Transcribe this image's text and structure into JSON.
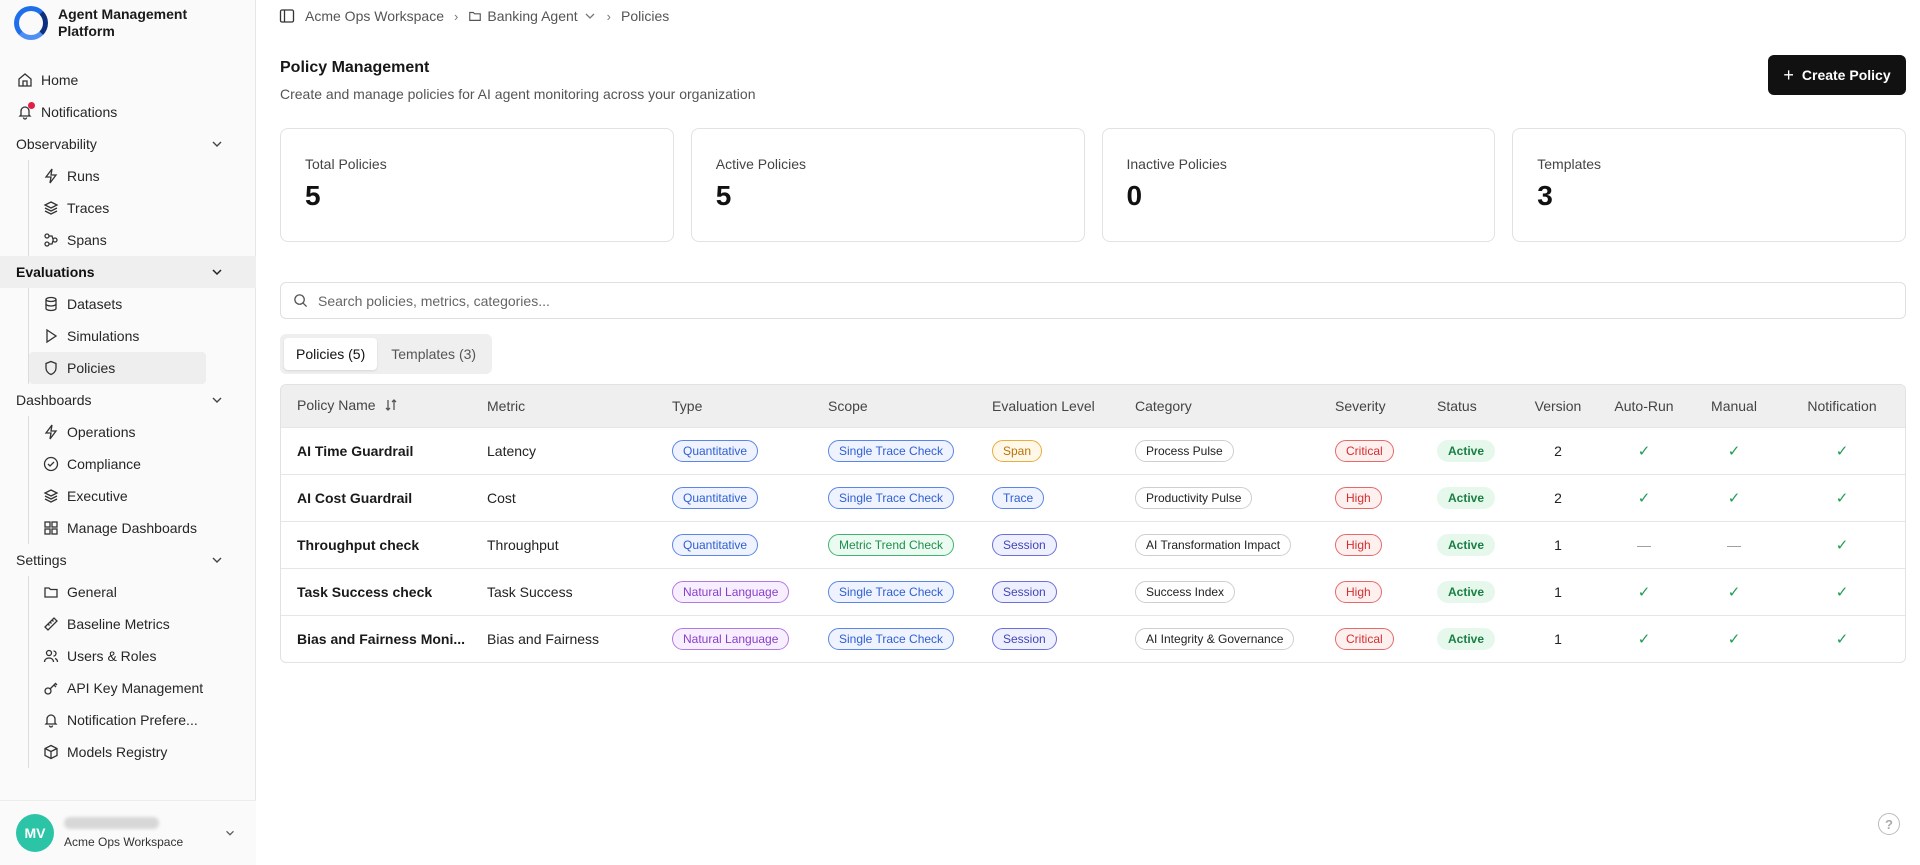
{
  "app": {
    "title": "Agent Management Platform"
  },
  "nav": {
    "home": "Home",
    "notifications": "Notifications",
    "observability": {
      "label": "Observability",
      "items": [
        "Runs",
        "Traces",
        "Spans"
      ]
    },
    "evaluations": {
      "label": "Evaluations",
      "items": [
        "Datasets",
        "Simulations",
        "Policies"
      ]
    },
    "dashboards": {
      "label": "Dashboards",
      "items": [
        "Operations",
        "Compliance",
        "Executive",
        "Manage Dashboards"
      ]
    },
    "settings": {
      "label": "Settings",
      "items": [
        "General",
        "Baseline Metrics",
        "Users & Roles",
        "API Key Management",
        "Notification Prefere...",
        "Models Registry"
      ]
    }
  },
  "user": {
    "initials": "MV",
    "workspace": "Acme Ops Workspace"
  },
  "breadcrumb": {
    "workspace": "Acme Ops Workspace",
    "agent": "Banking Agent",
    "page": "Policies"
  },
  "page": {
    "title": "Policy Management",
    "subtitle": "Create and manage policies for AI agent monitoring across your organization",
    "create_label": "Create Policy"
  },
  "stats": [
    {
      "label": "Total Policies",
      "value": "5"
    },
    {
      "label": "Active Policies",
      "value": "5"
    },
    {
      "label": "Inactive Policies",
      "value": "0"
    },
    {
      "label": "Templates",
      "value": "3"
    }
  ],
  "search": {
    "placeholder": "Search policies, metrics, categories..."
  },
  "tabs": [
    "Policies (5)",
    "Templates (3)"
  ],
  "table": {
    "columns": [
      "Policy Name",
      "Metric",
      "Type",
      "Scope",
      "Evaluation Level",
      "Category",
      "Severity",
      "Status",
      "Version",
      "Auto-Run",
      "Manual",
      "Notification"
    ],
    "rows": [
      {
        "name": "AI Time Guardrail",
        "metric": "Latency",
        "type": "Quantitative",
        "scope": "Single Trace Check",
        "level": "Span",
        "category": "Process Pulse",
        "severity": "Critical",
        "status": "Active",
        "version": "2",
        "auto": "✓",
        "manual": "✓",
        "notify": "✓"
      },
      {
        "name": "AI Cost Guardrail",
        "metric": "Cost",
        "type": "Quantitative",
        "scope": "Single Trace Check",
        "level": "Trace",
        "category": "Productivity Pulse",
        "severity": "High",
        "status": "Active",
        "version": "2",
        "auto": "✓",
        "manual": "✓",
        "notify": "✓"
      },
      {
        "name": "Throughput check",
        "metric": "Throughput",
        "type": "Quantitative",
        "scope": "Metric Trend Check",
        "level": "Session",
        "category": "AI Transformation Impact",
        "severity": "High",
        "status": "Active",
        "version": "1",
        "auto": "—",
        "manual": "—",
        "notify": "✓"
      },
      {
        "name": "Task Success check",
        "metric": "Task Success",
        "type": "Natural Language",
        "scope": "Single Trace Check",
        "level": "Session",
        "category": "Success Index",
        "severity": "High",
        "status": "Active",
        "version": "1",
        "auto": "✓",
        "manual": "✓",
        "notify": "✓"
      },
      {
        "name": "Bias and Fairness Moni...",
        "metric": "Bias and Fairness",
        "type": "Natural Language",
        "scope": "Single Trace Check",
        "level": "Session",
        "category": "AI Integrity & Governance",
        "severity": "Critical",
        "status": "Active",
        "version": "1",
        "auto": "✓",
        "manual": "✓",
        "notify": "✓"
      }
    ]
  },
  "colors": {
    "accent": "#1f6feb",
    "primary_button": "#111111",
    "active_status": "#1a7f43"
  }
}
